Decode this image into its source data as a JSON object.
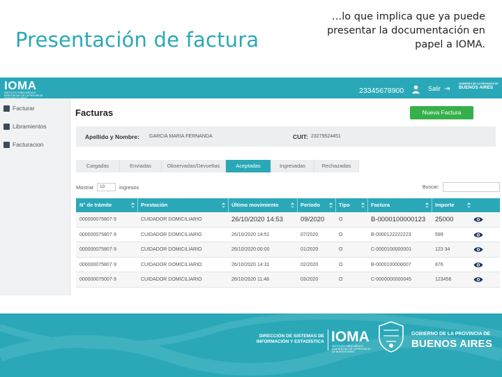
{
  "slide": {
    "title": "Presentación de factura",
    "note": "…lo que implica que ya puede presentar la documentación en papel a IOMA."
  },
  "app": {
    "logo_main": "IOMA",
    "logo_sub": "INSTITUTO OBRA MÉDICO ASISTENCIAL DE LA PROVINCIA DE BUENOS AIRES",
    "user_id": "23345678900",
    "logout_label": "Salir",
    "gov_badge_line1": "GOBIERNO DE LA PROVINCIA DE",
    "gov_badge_line2": "BUENOS AIRES",
    "sidebar": [
      {
        "label": "Facturar",
        "icon": "document-icon"
      },
      {
        "label": "Libramientos",
        "icon": "users-icon"
      },
      {
        "label": "Facturacion",
        "icon": "folder-icon"
      }
    ],
    "page_title": "Facturas",
    "new_invoice_button": "Nueva Factura",
    "info": {
      "name_label": "Apellido y Nombre:",
      "name_value": "GARCIA MARIA FERNANDA",
      "cuit_label": "CUIT:",
      "cuit_value": "23279524451"
    },
    "tabs": [
      {
        "label": "Cargadas",
        "active": false
      },
      {
        "label": "Enviadas",
        "active": false
      },
      {
        "label": "Observadas/Devueltas",
        "active": false
      },
      {
        "label": "Aceptadas",
        "active": true
      },
      {
        "label": "Ingresadas",
        "active": false
      },
      {
        "label": "Rechazadas",
        "active": false
      }
    ],
    "show_label": "Mostrar",
    "show_value": "10",
    "entries_label": "ingresos",
    "search_label": "Buscar:",
    "search_value": "",
    "table": {
      "columns": [
        "N° de trámite",
        "Prestación",
        "Último movimiento",
        "Periodo",
        "Tipo",
        "Factura",
        "Importe"
      ],
      "rows": [
        [
          "000000075807·9",
          "CUIDADOR DOMICILIARIO",
          "26/10/2020 14:53",
          "09/2020",
          "O",
          "B-0000100000123",
          "25000"
        ],
        [
          "000000075807·9",
          "CUIDADOR DOMICILIARIO",
          "26/10/2020 14:51",
          "07/2020",
          "O",
          "B-0000122222223",
          "599"
        ],
        [
          "000000075807·9",
          "CUIDADOR DOMICILIARIO",
          "26/10/2020 00:00",
          "01/2020",
          "O",
          "C-0000100000001",
          "123 34"
        ],
        [
          "000000075807·9",
          "CUIDADOR DOMICILIARIO",
          "26/10/2020 14:31",
          "02/2020",
          "O",
          "B-0000100000007",
          "876"
        ],
        [
          "000000075007·9",
          "CUIDADOR DOMICILIARIO",
          "26/10/2020 11:48",
          "03/2020",
          "O",
          "C-0000000000045",
          "123456"
        ]
      ]
    }
  },
  "footer": {
    "direction_line1": "DIRECCIÓN DE SISTEMAS DE",
    "direction_line2": "INFORMACIÓN Y ESTADÍSTICA",
    "ioma": "IOMA",
    "ioma_sub": "INSTITUTO OBRA MÉDICO ASISTENCIAL DE LA PROVINCIA DE BUENOS AIRES",
    "gov_line1": "GOBIERNO DE LA PROVINCIA DE",
    "gov_line2": "BUENOS AIRES"
  },
  "colors": {
    "accent": "#2aa8b8",
    "button_green": "#35b04a",
    "eye_icon": "#1f3a5c"
  }
}
